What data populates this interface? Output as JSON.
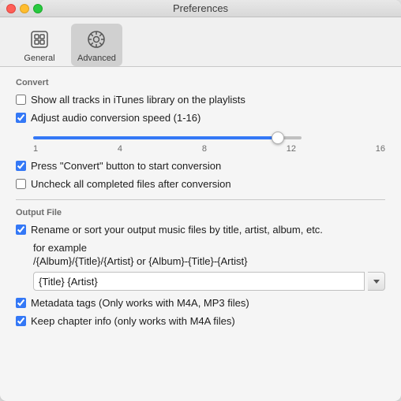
{
  "window": {
    "title": "Preferences"
  },
  "toolbar": {
    "items": [
      {
        "id": "general",
        "label": "General",
        "active": false
      },
      {
        "id": "advanced",
        "label": "Advanced",
        "active": true
      }
    ]
  },
  "convert_section": {
    "title": "Convert",
    "options": [
      {
        "id": "show-all-tracks",
        "label": "Show all tracks in iTunes library on the playlists",
        "checked": false
      },
      {
        "id": "adjust-audio-speed",
        "label": "Adjust audio conversion speed (1-16)",
        "checked": true
      },
      {
        "id": "press-convert",
        "label": "Press \"Convert\" button to start conversion",
        "checked": true
      },
      {
        "id": "uncheck-completed",
        "label": "Uncheck all completed files after conversion",
        "checked": false
      }
    ],
    "slider": {
      "min": 1,
      "max": 16,
      "value": 15,
      "labels": [
        "1",
        "4",
        "8",
        "12",
        "16"
      ]
    }
  },
  "output_section": {
    "title": "Output File",
    "rename_option": {
      "id": "rename-sort",
      "label": "Rename or sort your output music files by title, artist, album, etc.",
      "checked": true
    },
    "for_example_label": "for example",
    "format_example": "/{Album}/{Title}/{Artist} or {Album}-{Title}-{Artist}",
    "format_input_value": "{Title} {Artist}",
    "options": [
      {
        "id": "metadata-tags",
        "label": "Metadata tags (Only works with M4A, MP3 files)",
        "checked": true
      },
      {
        "id": "keep-chapter",
        "label": "Keep chapter info (only works with  M4A files)",
        "checked": true
      }
    ]
  }
}
